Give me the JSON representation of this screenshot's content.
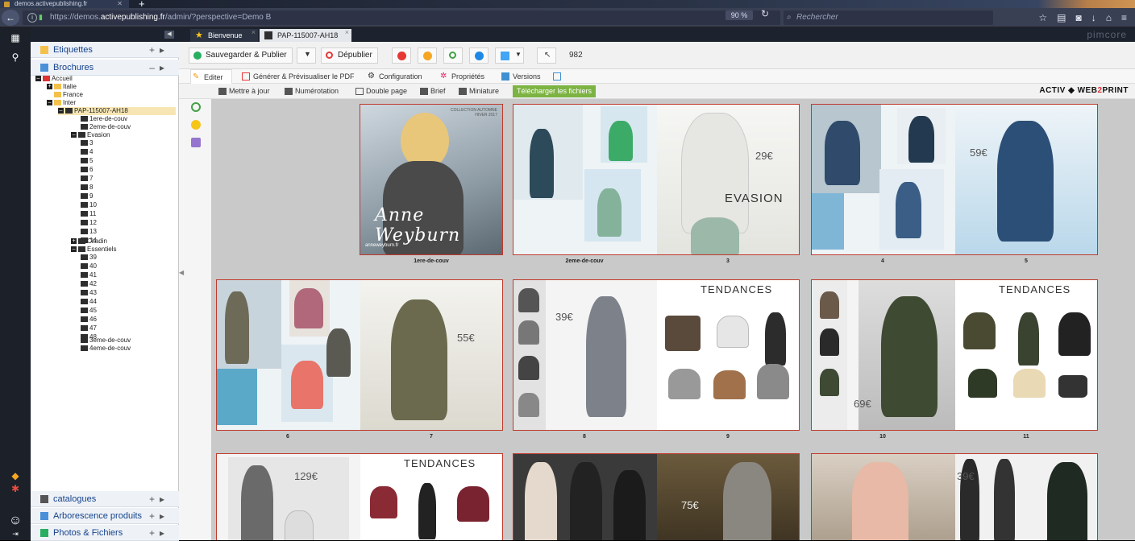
{
  "browser": {
    "tab_title": "demos.activepublishing.fr",
    "url_prefix": "https://demos.",
    "url_domain": "activepublishing.fr",
    "url_path": "/admin/?perspective=Demo B",
    "zoom": "90 %",
    "search_placeholder": "Rechercher"
  },
  "sidebar": {
    "etiquettes": "Etiquettes",
    "brochures": "Brochures",
    "tree": {
      "accueil": "Accueil",
      "italie": "Italie",
      "france": "France",
      "inter": "Inter",
      "pap": "PAP-115007-AH18",
      "couv1": "1ere-de-couv",
      "couv2": "2eme-de-couv",
      "evasion": "Evasion",
      "evasion_pages": [
        "3",
        "4",
        "5",
        "6",
        "7",
        "8",
        "9",
        "10",
        "11",
        "12",
        "13",
        "14"
      ],
      "citadin": "Citadin",
      "essentiels": "Essentiels",
      "essentiels_pages": [
        "39",
        "40",
        "41",
        "42",
        "43",
        "44",
        "45",
        "46",
        "47",
        "48"
      ],
      "couv3": "3eme-de-couv",
      "couv4": "4eme-de-couv"
    },
    "catalogues": "catalogues",
    "arborescence": "Arborescence produits",
    "photos": "Photos & Fichiers"
  },
  "tabs": {
    "welcome": "Bienvenue",
    "document": "PAP-115007-AH18",
    "brand_text": "pimcore"
  },
  "toolbar": {
    "save_publish": "Sauvegarder & Publier",
    "unpublish": "Dépublier",
    "count": "982"
  },
  "subtabs": {
    "edit": "Editer",
    "pdf": "Générer & Prévisualiser le PDF",
    "config": "Configuration",
    "props": "Propriétés",
    "versions": "Versions"
  },
  "actions": {
    "update": "Mettre à jour",
    "numbering": "Numérotation",
    "double": "Double page",
    "brief": "Brief",
    "mini": "Miniature",
    "download": "Télécharger les fichiers",
    "brand_activ": "ACTIV",
    "brand_web": "WEB",
    "brand_2": "2",
    "brand_print": "PRINT"
  },
  "pages": {
    "cover_title": "Anne Weyburn",
    "cover_tag": "COLLECTION AUTOMNE HIVER 2017",
    "cover_url": "anneweyburn.fr",
    "evasion": "EVASION",
    "tendances": "TENDANCES",
    "price_29": "29€",
    "price_59": "59€",
    "price_55": "55€",
    "price_39": "39€",
    "price_69": "69€",
    "price_129": "129€",
    "price_75": "75€",
    "price_39b": "39€",
    "labels": [
      "1ere-de-couv",
      "2eme-de-couv",
      "3",
      "4",
      "5",
      "6",
      "7",
      "8",
      "9",
      "10",
      "11"
    ]
  },
  "colors": {
    "accent_green": "#7cb342",
    "spread_border": "#c0392b",
    "link_blue": "#15428b"
  }
}
